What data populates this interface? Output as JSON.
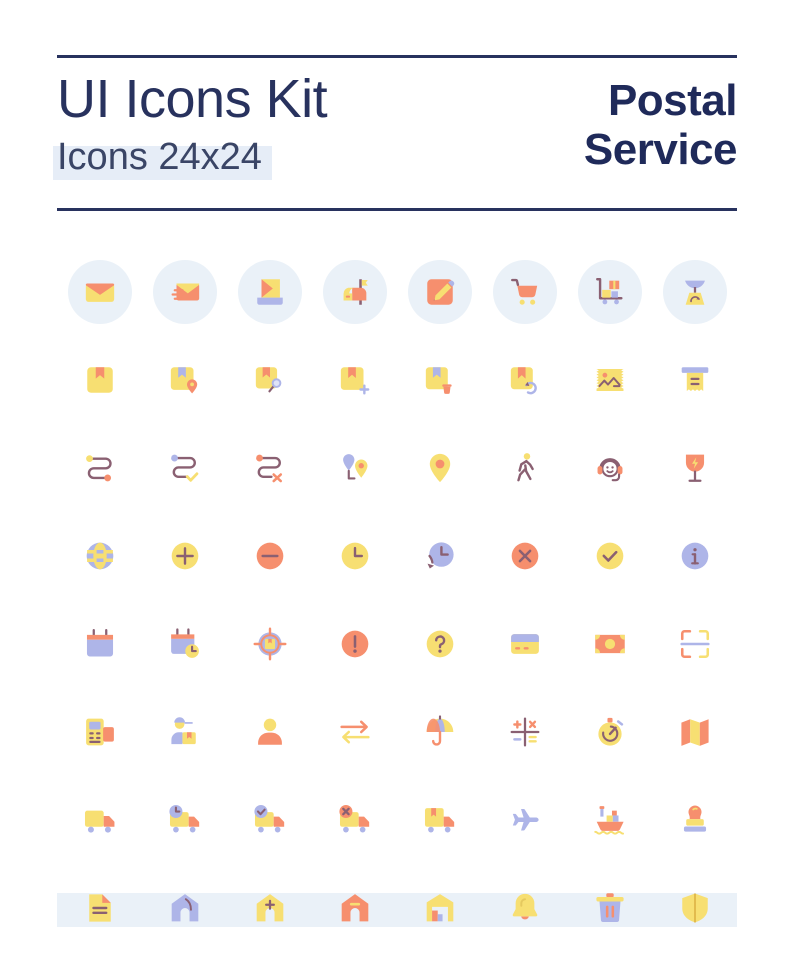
{
  "header": {
    "title": "UI Icons Kit",
    "subtitle": "Icons 24x24",
    "brand_line1": "Postal",
    "brand_line2": "Service",
    "rule_color": "#28325e",
    "highlight_color": "#e6edf7"
  },
  "palette": {
    "navy": "#28325e",
    "yellow": "#f7df72",
    "orange": "#f68f6e",
    "periwinkle": "#aeb5e8",
    "plum_stroke": "#8a6072",
    "circle_bg": "#eaf1f8",
    "band": "#eaf1f8",
    "white": "#ffffff"
  },
  "grid": {
    "columns": 8,
    "rows": 8,
    "icon_size_label": "24x24",
    "row1_has_circle_background": true
  },
  "icons": [
    {
      "name": "envelope-icon",
      "label": "Envelope",
      "row": 1,
      "col": 1
    },
    {
      "name": "envelope-send-icon",
      "label": "Send mail",
      "row": 1,
      "col": 2
    },
    {
      "name": "mail-inbox-icon",
      "label": "Mail inbox",
      "row": 1,
      "col": 3
    },
    {
      "name": "mailbox-icon",
      "label": "Mailbox",
      "row": 1,
      "col": 4
    },
    {
      "name": "compose-edit-icon",
      "label": "Compose",
      "row": 1,
      "col": 5
    },
    {
      "name": "shopping-cart-icon",
      "label": "Shopping cart",
      "row": 1,
      "col": 6
    },
    {
      "name": "parcel-trolley-icon",
      "label": "Parcel trolley",
      "row": 1,
      "col": 7
    },
    {
      "name": "weight-scale-icon",
      "label": "Weight scale",
      "row": 1,
      "col": 8
    },
    {
      "name": "package-box-icon",
      "label": "Package",
      "row": 2,
      "col": 1
    },
    {
      "name": "package-location-icon",
      "label": "Package location",
      "row": 2,
      "col": 2
    },
    {
      "name": "package-search-icon",
      "label": "Search package",
      "row": 2,
      "col": 3
    },
    {
      "name": "package-add-icon",
      "label": "Add package",
      "row": 2,
      "col": 4
    },
    {
      "name": "package-delete-icon",
      "label": "Delete package",
      "row": 2,
      "col": 5
    },
    {
      "name": "package-return-icon",
      "label": "Return package",
      "row": 2,
      "col": 6
    },
    {
      "name": "postage-stamp-icon",
      "label": "Postage stamp",
      "row": 2,
      "col": 7
    },
    {
      "name": "receipt-print-icon",
      "label": "Receipt",
      "row": 2,
      "col": 8
    },
    {
      "name": "route-icon",
      "label": "Route",
      "row": 3,
      "col": 1
    },
    {
      "name": "route-check-icon",
      "label": "Route completed",
      "row": 3,
      "col": 2
    },
    {
      "name": "route-cancel-icon",
      "label": "Route cancelled",
      "row": 3,
      "col": 3
    },
    {
      "name": "map-pins-route-icon",
      "label": "Pins route",
      "row": 3,
      "col": 4
    },
    {
      "name": "map-pin-icon",
      "label": "Map pin",
      "row": 3,
      "col": 5
    },
    {
      "name": "courier-walking-icon",
      "label": "Walking courier",
      "row": 3,
      "col": 6
    },
    {
      "name": "support-headset-icon",
      "label": "Customer support",
      "row": 3,
      "col": 7
    },
    {
      "name": "fragile-glass-icon",
      "label": "Fragile",
      "row": 3,
      "col": 8
    },
    {
      "name": "globe-icon",
      "label": "International",
      "row": 4,
      "col": 1
    },
    {
      "name": "plus-circle-icon",
      "label": "Add",
      "row": 4,
      "col": 2
    },
    {
      "name": "minus-circle-icon",
      "label": "Remove",
      "row": 4,
      "col": 3
    },
    {
      "name": "clock-icon",
      "label": "Clock",
      "row": 4,
      "col": 4
    },
    {
      "name": "clock-history-icon",
      "label": "History",
      "row": 4,
      "col": 5
    },
    {
      "name": "close-circle-icon",
      "label": "Cancel",
      "row": 4,
      "col": 6
    },
    {
      "name": "check-circle-icon",
      "label": "Confirmed",
      "row": 4,
      "col": 7
    },
    {
      "name": "info-circle-icon",
      "label": "Information",
      "row": 4,
      "col": 8
    },
    {
      "name": "calendar-icon",
      "label": "Calendar",
      "row": 5,
      "col": 1
    },
    {
      "name": "calendar-time-icon",
      "label": "Schedule",
      "row": 5,
      "col": 2
    },
    {
      "name": "package-tracking-target-icon",
      "label": "Track package",
      "row": 5,
      "col": 3
    },
    {
      "name": "alert-circle-icon",
      "label": "Alert",
      "row": 5,
      "col": 4
    },
    {
      "name": "help-circle-icon",
      "label": "Help",
      "row": 5,
      "col": 5
    },
    {
      "name": "credit-card-icon",
      "label": "Credit card",
      "row": 5,
      "col": 6
    },
    {
      "name": "cash-banknote-icon",
      "label": "Cash payment",
      "row": 5,
      "col": 7
    },
    {
      "name": "barcode-scan-icon",
      "label": "Scan code",
      "row": 5,
      "col": 8
    },
    {
      "name": "payment-terminal-icon",
      "label": "Payment terminal",
      "row": 6,
      "col": 1
    },
    {
      "name": "courier-parcel-icon",
      "label": "Courier",
      "row": 6,
      "col": 2
    },
    {
      "name": "user-icon",
      "label": "User",
      "row": 6,
      "col": 3
    },
    {
      "name": "transfer-arrows-icon",
      "label": "Transfer",
      "row": 6,
      "col": 4
    },
    {
      "name": "umbrella-insurance-icon",
      "label": "Insurance",
      "row": 6,
      "col": 5
    },
    {
      "name": "calculator-math-icon",
      "label": "Calculate cost",
      "row": 6,
      "col": 6
    },
    {
      "name": "stopwatch-icon",
      "label": "Express delivery",
      "row": 6,
      "col": 7
    },
    {
      "name": "folded-map-icon",
      "label": "Map",
      "row": 6,
      "col": 8
    },
    {
      "name": "delivery-truck-icon",
      "label": "Delivery truck",
      "row": 7,
      "col": 1
    },
    {
      "name": "truck-time-icon",
      "label": "Delivery time",
      "row": 7,
      "col": 2
    },
    {
      "name": "truck-check-icon",
      "label": "Delivered",
      "row": 7,
      "col": 3
    },
    {
      "name": "truck-cancel-icon",
      "label": "Delivery cancelled",
      "row": 7,
      "col": 4
    },
    {
      "name": "truck-package-icon",
      "label": "Truck with package",
      "row": 7,
      "col": 5
    },
    {
      "name": "airplane-icon",
      "label": "Air mail",
      "row": 7,
      "col": 6
    },
    {
      "name": "cargo-ship-icon",
      "label": "Sea freight",
      "row": 7,
      "col": 7
    },
    {
      "name": "rubber-stamp-icon",
      "label": "Stamp",
      "row": 7,
      "col": 8
    },
    {
      "name": "document-icon",
      "label": "Document",
      "row": 8,
      "col": 1
    },
    {
      "name": "home-address-icon",
      "label": "Home address",
      "row": 8,
      "col": 2
    },
    {
      "name": "home-add-icon",
      "label": "Add address",
      "row": 8,
      "col": 3
    },
    {
      "name": "home-remove-icon",
      "label": "Remove address",
      "row": 8,
      "col": 4
    },
    {
      "name": "warehouse-icon",
      "label": "Warehouse",
      "row": 8,
      "col": 5
    },
    {
      "name": "notification-bell-icon",
      "label": "Notifications",
      "row": 8,
      "col": 6
    },
    {
      "name": "trash-icon",
      "label": "Delete",
      "row": 8,
      "col": 7
    },
    {
      "name": "shield-icon",
      "label": "Protection",
      "row": 8,
      "col": 8
    }
  ]
}
